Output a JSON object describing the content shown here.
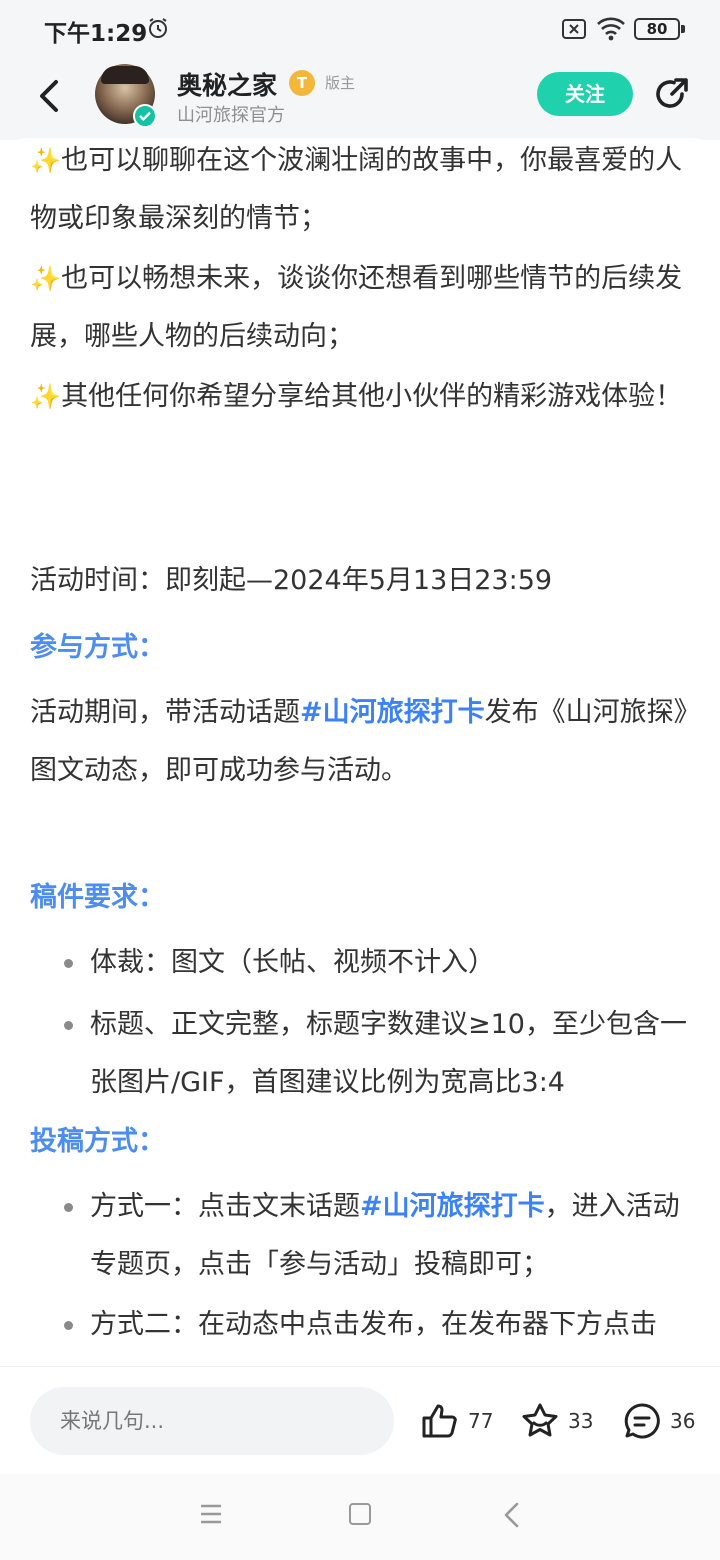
{
  "status_bar": {
    "time": "下午1:29",
    "battery": "80"
  },
  "header": {
    "user_name": "奥秘之家",
    "level_badge": "T",
    "role_tag": "版主",
    "sub_title": "山河旅探官方",
    "follow_label": "关注"
  },
  "content": {
    "spark": "✨",
    "p1": "也可以聊聊在这个波澜壮阔的故事中，你最喜爱的人物或印象最深刻的情节；",
    "p2": "也可以畅想未来，谈谈你还想看到哪些情节的后续发展，哪些人物的后续动向；",
    "p3": "其他任何你希望分享给其他小伙伴的精彩游戏体验！",
    "activity_time": "活动时间：即刻起—2024年5月13日23:59",
    "participate_title": "参与方式：",
    "participate_pre": "活动期间，带活动话题",
    "hashtag": "#山河旅探打卡",
    "participate_post": "发布《山河旅探》图文动态，即可成功参与活动。",
    "requirements_title": "稿件要求：",
    "req1": "体裁：图文（长帖、视频不计入）",
    "req2": "标题、正文完整，标题字数建议≥10，至少包含一张图片/GIF，首图建议比例为宽高比3:4",
    "submit_title": "投稿方式：",
    "way1_pre": "方式一：点击文末话题",
    "way1_post": "，进入活动专题页，点击「参与活动」投稿即可；",
    "way2": "方式二：在动态中点击发布，在发布器下方点击"
  },
  "bottom_bar": {
    "comment_placeholder": "来说几句...",
    "likes": "77",
    "favorites": "33",
    "comments": "36"
  },
  "colors": {
    "accent": "#1fd1ad",
    "link": "#3b82f6",
    "section": "#4d8df0"
  }
}
